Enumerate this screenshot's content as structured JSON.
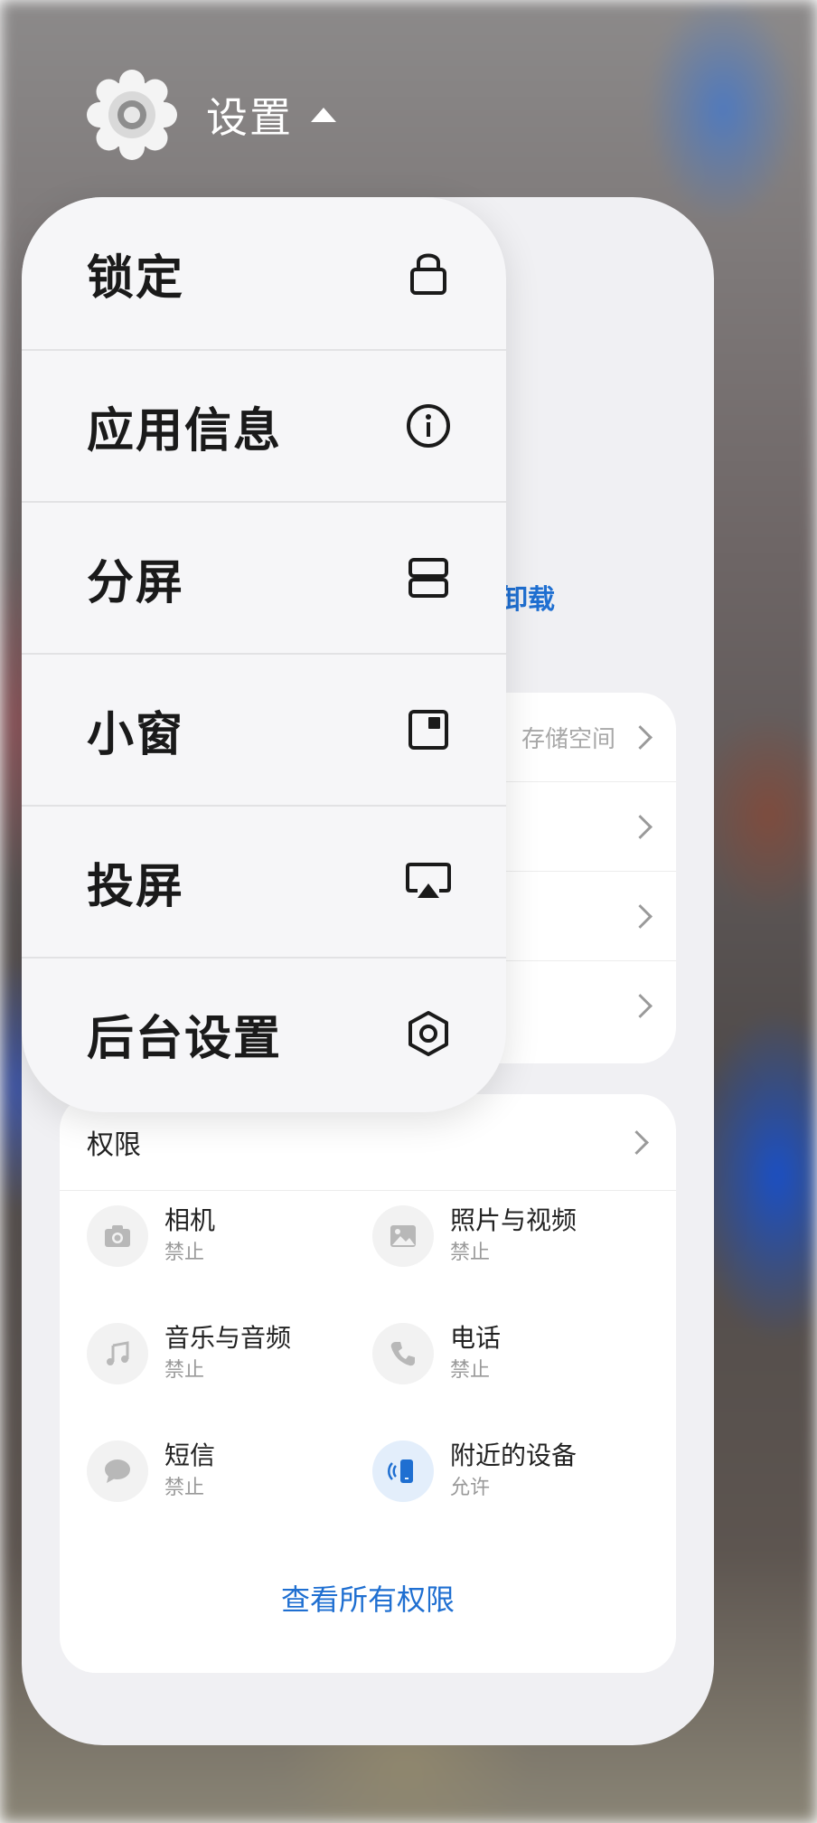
{
  "app": {
    "title": "设置",
    "icon": "gear-icon"
  },
  "menu": {
    "items": [
      {
        "label": "锁定",
        "icon": "lock-icon"
      },
      {
        "label": "应用信息",
        "icon": "info-icon"
      },
      {
        "label": "分屏",
        "icon": "split-screen-icon"
      },
      {
        "label": "小窗",
        "icon": "small-window-icon"
      },
      {
        "label": "投屏",
        "icon": "cast-icon"
      },
      {
        "label": "后台设置",
        "icon": "hexagon-settings-icon"
      }
    ]
  },
  "card": {
    "uninstall_partial": "卸载",
    "storage_hint_partial": "存储空间"
  },
  "permissions": {
    "title": "权限",
    "items": [
      {
        "name": "相机",
        "status": "禁止",
        "icon": "camera-icon"
      },
      {
        "name": "照片与视频",
        "status": "禁止",
        "icon": "photo-icon"
      },
      {
        "name": "音乐与音频",
        "status": "禁止",
        "icon": "music-icon"
      },
      {
        "name": "电话",
        "status": "禁止",
        "icon": "phone-icon"
      },
      {
        "name": "短信",
        "status": "禁止",
        "icon": "message-icon"
      },
      {
        "name": "附近的设备",
        "status": "允许",
        "icon": "nearby-device-icon"
      }
    ],
    "view_all": "查看所有权限"
  },
  "colors": {
    "accent": "#1f6fd1",
    "menu_bg": "#f6f6f8",
    "card_bg": "#f0f0f3"
  }
}
